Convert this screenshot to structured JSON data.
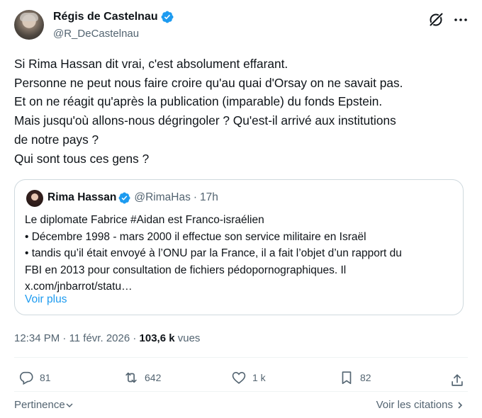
{
  "author": {
    "name": "Régis de Castelnau",
    "handle": "@R_DeCastelnau"
  },
  "tweet_lines": [
    "Si Rima Hassan dit vrai, c'est absolument effarant.",
    "Personne ne peut nous faire croire qu'au quai d'Orsay on ne savait pas.",
    "Et on ne réagit qu'après la publication (imparable) du fonds Epstein.",
    "Mais jusqu'où allons-nous dégringoler ? Qu'est-il arrivé aux institutions",
    "de notre pays ?",
    "Qui sont tous ces gens ?"
  ],
  "quote": {
    "name": "Rima Hassan",
    "handle": "@RimaHas",
    "separator": "·",
    "time": "17h",
    "lines": [
      "Le diplomate Fabrice #Aidan est Franco-israélien",
      "• Décembre 1998 - mars 2000 il effectue son service militaire en Israël",
      "• tandis qu’il était envoyé à l’ONU par la France, il a fait l’objet d’un rapport du",
      "FBI en 2013 pour consultation de fichiers pédopornographiques. Il",
      "x.com/jnbarrot/statu…"
    ],
    "show_more": "Voir plus"
  },
  "meta": {
    "time": "12:34 PM",
    "date": "11 févr. 2026",
    "views_count": "103,6 k",
    "views_label": "vues"
  },
  "actions": {
    "replies": "81",
    "retweets": "642",
    "likes": "1 k",
    "bookmarks": "82"
  },
  "footer": {
    "sort_label": "Pertinence",
    "quotes_link": "Voir les citations"
  },
  "icons": [
    "verified-badge-icon",
    "grok-icon",
    "more-icon",
    "reply-icon",
    "retweet-icon",
    "like-icon",
    "bookmark-icon",
    "share-icon",
    "chevron-down-icon",
    "chevron-right-icon"
  ],
  "colors": {
    "accent": "#1d9bf0",
    "text": "#0f1419",
    "muted": "#536471",
    "border": "#cfd9de"
  }
}
